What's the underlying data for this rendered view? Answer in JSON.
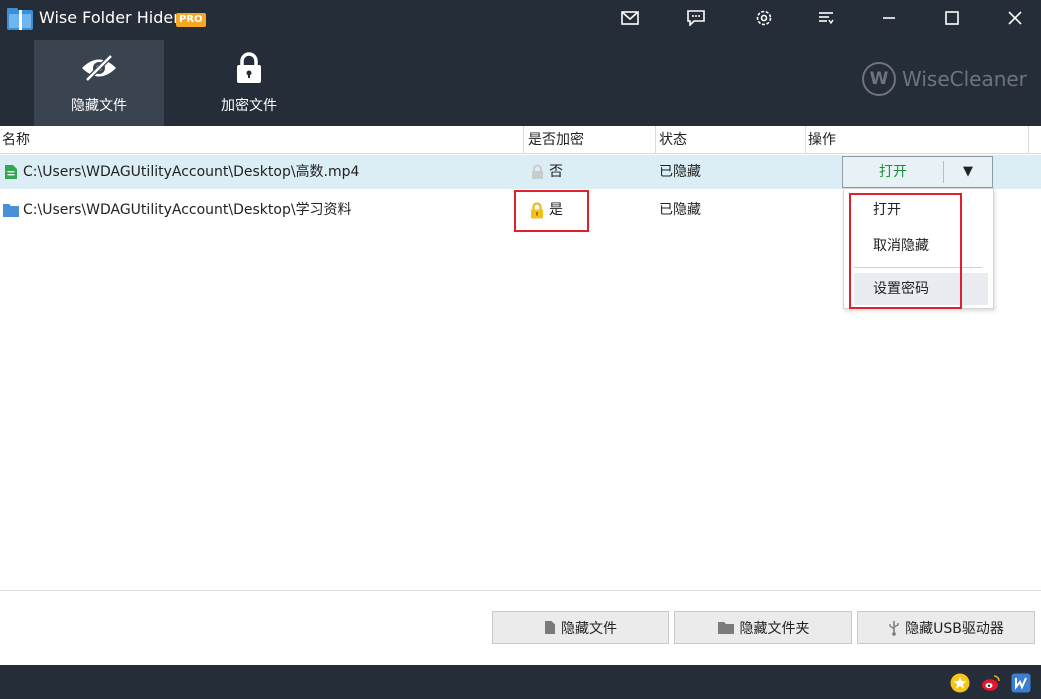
{
  "app": {
    "title": "Wise Folder Hider",
    "badge": "PRO"
  },
  "titlebar": {
    "icons": [
      "mail-icon",
      "feedback-icon",
      "settings-icon",
      "menu-icon",
      "minimize-icon",
      "maximize-icon",
      "close-icon"
    ]
  },
  "toolbar": {
    "tabs": [
      {
        "label": "隐藏文件",
        "icon": "eye-slash-icon",
        "active": true
      },
      {
        "label": "加密文件",
        "icon": "lock-icon",
        "active": false
      }
    ]
  },
  "brand": {
    "letter": "W",
    "name": "WiseCleaner"
  },
  "table": {
    "headers": {
      "name": "名称",
      "encrypted": "是否加密",
      "status": "状态",
      "action": "操作"
    },
    "rows": [
      {
        "icon": "video-file-icon",
        "path": "C:\\Users\\WDAGUtilityAccount\\Desktop\\高数.mp4",
        "encrypted": "否",
        "status": "已隐藏",
        "selected": true
      },
      {
        "icon": "folder-icon",
        "path": "C:\\Users\\WDAGUtilityAccount\\Desktop\\学习资料",
        "encrypted": "是",
        "status": "已隐藏",
        "selected": false
      }
    ]
  },
  "action_button": {
    "label": "打开",
    "arrow": "▼"
  },
  "dropdown": {
    "items": [
      "打开",
      "取消隐藏",
      "设置密码"
    ]
  },
  "bottom_buttons": {
    "hide_file": "隐藏文件",
    "hide_folder": "隐藏文件夹",
    "hide_usb": "隐藏USB驱动器"
  },
  "colors": {
    "dark_bg": "#252d38",
    "active_tab": "#3a4350",
    "selected_row": "#dbeef6",
    "open_green": "#1e8f3a",
    "highlight_red": "#e0202a",
    "pro_orange": "#f5a623"
  }
}
